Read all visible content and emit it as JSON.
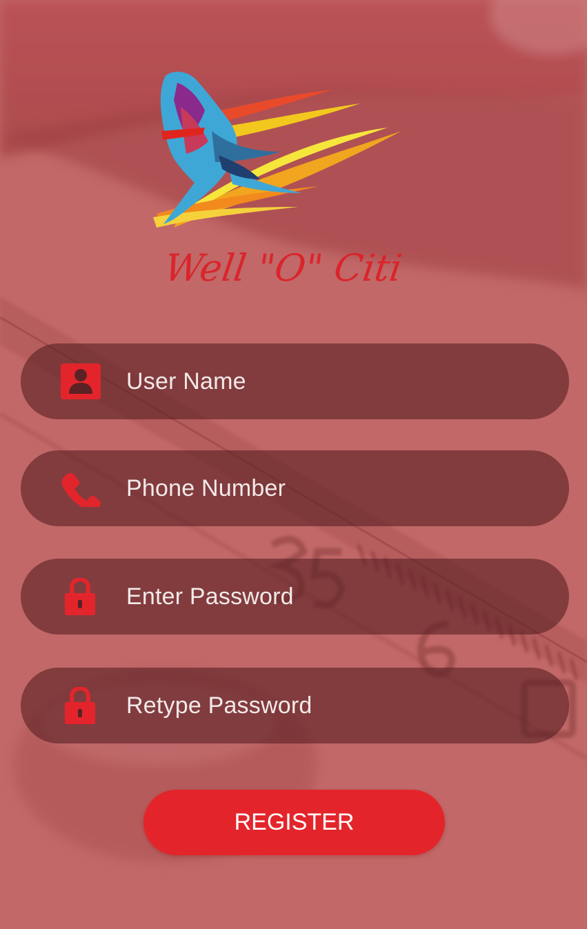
{
  "app": {
    "brand_name": "Well \"O\" Citi",
    "colors": {
      "accent": "#e3252b",
      "background": "#c06464",
      "field_background": "#5a2224",
      "placeholder_text": "#f3e9e9"
    }
  },
  "form": {
    "fields": [
      {
        "placeholder": "User Name",
        "icon": "user-icon"
      },
      {
        "placeholder": "Phone Number",
        "icon": "phone-icon"
      },
      {
        "placeholder": "Enter Password",
        "icon": "lock-icon"
      },
      {
        "placeholder": "Retype Password",
        "icon": "lock-icon"
      }
    ],
    "submit_label": "REGISTER"
  }
}
